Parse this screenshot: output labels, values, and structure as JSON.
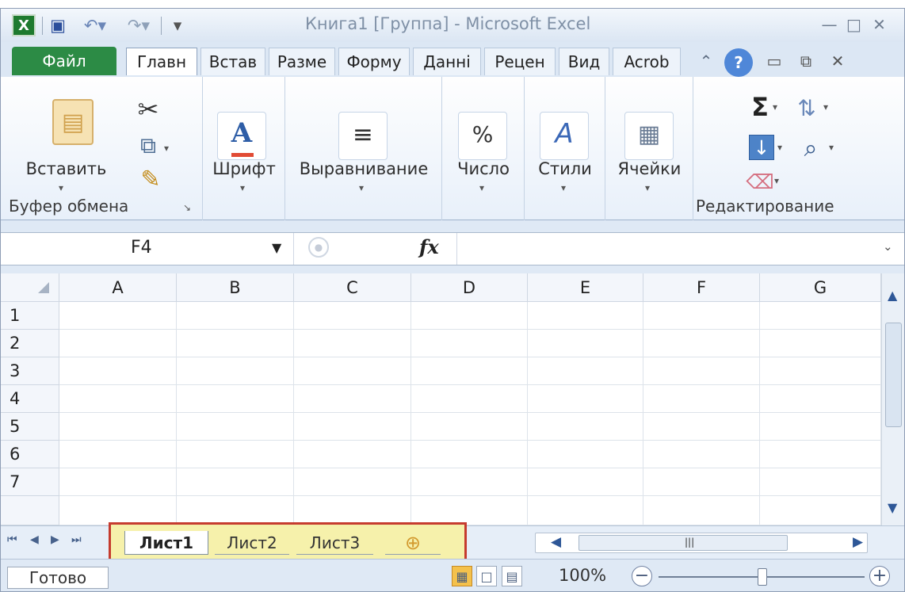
{
  "app": {
    "title": "Книга1 [Группа] - Microsoft Excel",
    "window_buttons": [
      "—",
      "□",
      "✕"
    ],
    "quick_access_icons": [
      "excel-icon",
      "save-icon",
      "undo-icon",
      "redo-icon",
      "dropdown-icon"
    ],
    "ribbon_icons": [
      "minimize-ribbon-icon",
      "help-icon",
      "window-restore-icon",
      "close-icon"
    ]
  },
  "tabs": {
    "file": "Файл",
    "home": "Главн",
    "items": [
      "Встав",
      "Разме",
      "Форму",
      "Данні",
      "Рецен",
      "Вид",
      "Acrob"
    ]
  },
  "ribbon": {
    "clipboard": {
      "paste": "Вставить",
      "group_label": "Буфер обмена"
    },
    "font": {
      "label": "Шрифт"
    },
    "alignment": {
      "label": "Выравнивание"
    },
    "number": {
      "label": "Число",
      "icon_text": "%"
    },
    "styles": {
      "label": "Стили"
    },
    "cells": {
      "label": "Ячейки"
    },
    "editing": {
      "group_label": "Редактирование",
      "sum_icon": "Σ"
    }
  },
  "formula_bar": {
    "cell_ref": "F4",
    "fx": "fx",
    "value": ""
  },
  "grid": {
    "columns": [
      "A",
      "B",
      "C",
      "D",
      "E",
      "F",
      "G"
    ],
    "rows": [
      "1",
      "2",
      "3",
      "4",
      "5",
      "6",
      "7"
    ]
  },
  "sheets": {
    "tabs": [
      "Лист1",
      "Лист2",
      "Лист3"
    ],
    "active": "Лист1",
    "highlight_color": "#c43224"
  },
  "status": {
    "ready": "Готово",
    "zoom": "100%"
  },
  "colors": {
    "file_tab": "#2c8b45",
    "ribbon_blue": "#dfe9f5",
    "active_tab": "#ffffff"
  }
}
